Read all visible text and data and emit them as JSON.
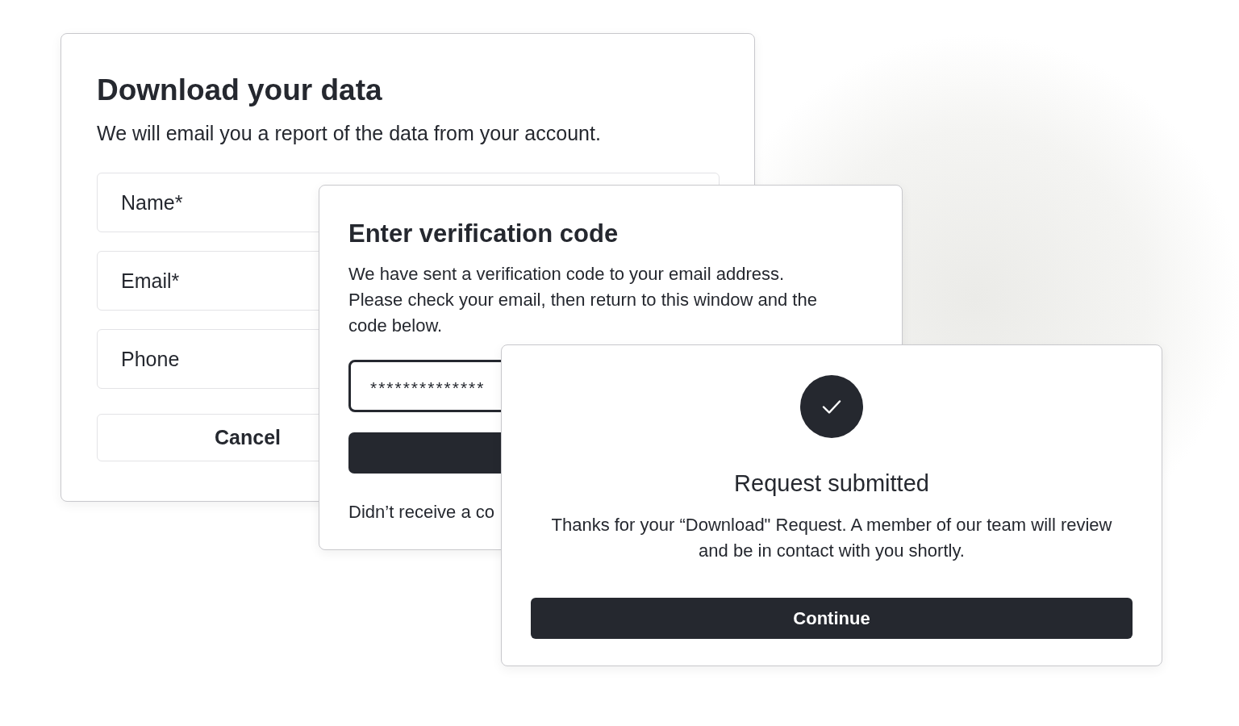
{
  "download_dialog": {
    "title": "Download your data",
    "description": "We will email you a report of the data from your account.",
    "fields": [
      {
        "placeholder": "Name*"
      },
      {
        "placeholder": "Email*"
      },
      {
        "placeholder": "Phone"
      }
    ],
    "cancel_button": "Cancel"
  },
  "verification_dialog": {
    "title": "Enter verification code",
    "description": "We have sent a verification code to your email address. Please check your email, then return to this window and the code below.",
    "code_value": "**************",
    "resend_text": "Didn’t receive a co"
  },
  "success_dialog": {
    "title": "Request submitted",
    "message": "Thanks for your “Download\" Request. A member of our team will review and be in contact with you shortly.",
    "continue_button": "Continue"
  }
}
